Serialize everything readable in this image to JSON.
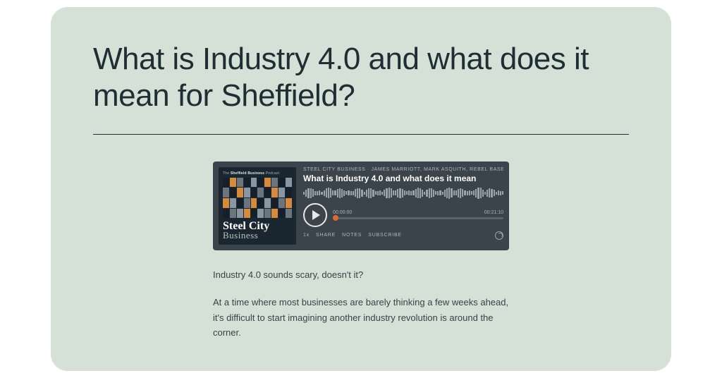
{
  "article": {
    "headline": "What is Industry 4.0 and what does it mean for Sheffield?",
    "intro1": "Industry 4.0 sounds scary, doesn't it?",
    "intro2": "At a time where most businesses are barely thinking a few weeks ahead, it's difficult to start imagining another industry revolution is around the corner."
  },
  "player": {
    "cover_top_pre": "The ",
    "cover_top_bold": "Sheffield Business",
    "cover_top_post": " Podcast",
    "brand1": "Steel City",
    "brand2": "Business",
    "meta": "STEEL CITY BUSINESS · JAMES MARRIOTT, MARK ASQUITH, REBEL BASE",
    "episode_title": "What is Industry 4.0 and what does it mean",
    "time_current": "00:00:00",
    "time_total": "00:21:10",
    "speed": "1x",
    "share": "SHARE",
    "notes": "NOTES",
    "subscribe": "SUBSCRIBE"
  }
}
